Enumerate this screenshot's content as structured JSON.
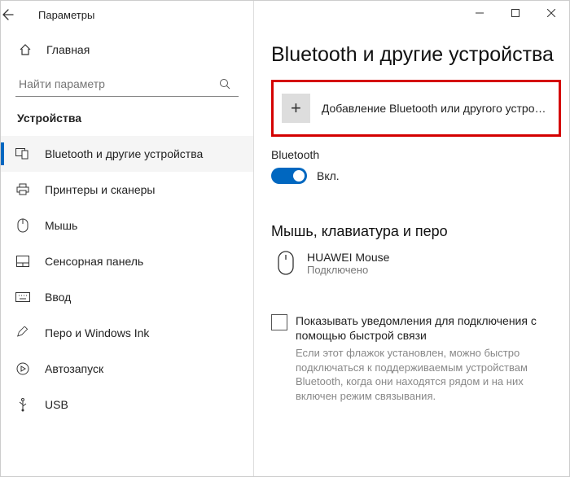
{
  "titlebar": {
    "title": "Параметры"
  },
  "sidebar": {
    "home": "Главная",
    "search_placeholder": "Найти параметр",
    "section": "Устройства",
    "items": [
      {
        "label": "Bluetooth и другие устройства"
      },
      {
        "label": "Принтеры и сканеры"
      },
      {
        "label": "Мышь"
      },
      {
        "label": "Сенсорная панель"
      },
      {
        "label": "Ввод"
      },
      {
        "label": "Перо и Windows Ink"
      },
      {
        "label": "Автозапуск"
      },
      {
        "label": "USB"
      }
    ]
  },
  "content": {
    "heading": "Bluetooth и другие устройства",
    "add_label": "Добавление Bluetooth или другого устройс…",
    "bt_section": "Bluetooth",
    "toggle_state": "Вкл.",
    "subheading": "Мышь, клавиатура и перо",
    "device": {
      "name": "HUAWEI  Mouse",
      "status": "Подключено"
    },
    "checkbox_label": "Показывать уведомления для подключения с помощью быстрой связи",
    "checkbox_hint": "Если этот флажок установлен, можно быстро подключаться к поддерживаемым устройствам Bluetooth, когда они находятся рядом и на них включен режим связывания."
  }
}
